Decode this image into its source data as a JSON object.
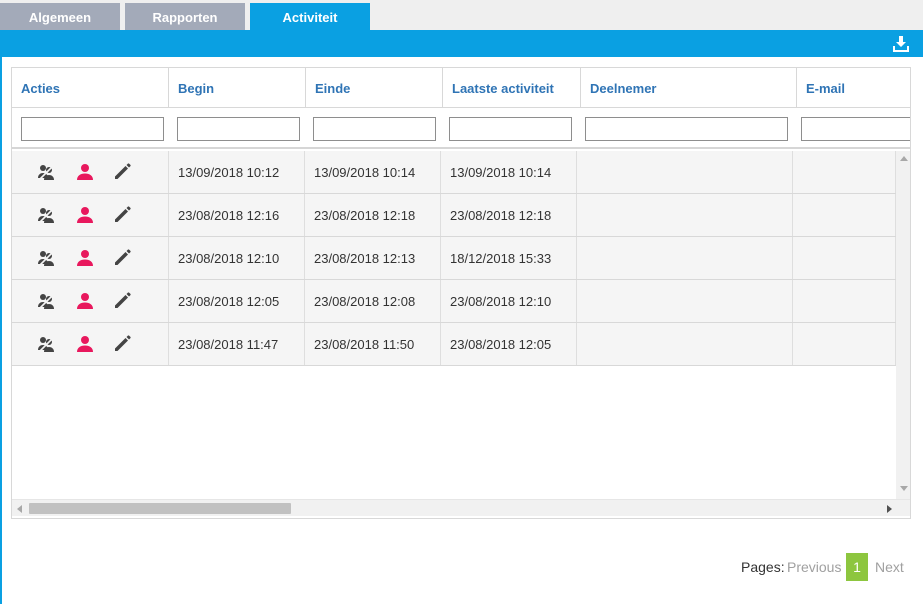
{
  "tabs": [
    {
      "label": "Algemeen"
    },
    {
      "label": "Rapporten"
    },
    {
      "label": "Activiteit"
    }
  ],
  "colors": {
    "accent": "#0aa0e2",
    "tab_inactive": "#a3aab9",
    "header_text": "#2f74b5",
    "person_icon": "#e8185d",
    "page_active": "#8dc63f"
  },
  "toolbar": {
    "download_icon": "download-icon"
  },
  "table": {
    "columns": [
      "Acties",
      "Begin",
      "Einde",
      "Laatste activiteit",
      "Deelnemer",
      "E-mail"
    ],
    "filters": [
      "",
      "",
      "",
      "",
      "",
      ""
    ],
    "action_icons": [
      "users-icon",
      "person-icon",
      "pencil-icon"
    ],
    "rows": [
      {
        "begin": "13/09/2018 10:12",
        "einde": "13/09/2018 10:14",
        "laatste": "13/09/2018 10:14",
        "deelnemer": "",
        "email": ""
      },
      {
        "begin": "23/08/2018 12:16",
        "einde": "23/08/2018 12:18",
        "laatste": "23/08/2018 12:18",
        "deelnemer": "",
        "email": ""
      },
      {
        "begin": "23/08/2018 12:10",
        "einde": "23/08/2018 12:13",
        "laatste": "18/12/2018 15:33",
        "deelnemer": "",
        "email": ""
      },
      {
        "begin": "23/08/2018 12:05",
        "einde": "23/08/2018 12:08",
        "laatste": "23/08/2018 12:10",
        "deelnemer": "",
        "email": ""
      },
      {
        "begin": "23/08/2018 11:47",
        "einde": "23/08/2018 11:50",
        "laatste": "23/08/2018 12:05",
        "deelnemer": "",
        "email": ""
      }
    ]
  },
  "pager": {
    "label": "Pages:",
    "previous": "Previous",
    "current": "1",
    "next": "Next"
  }
}
